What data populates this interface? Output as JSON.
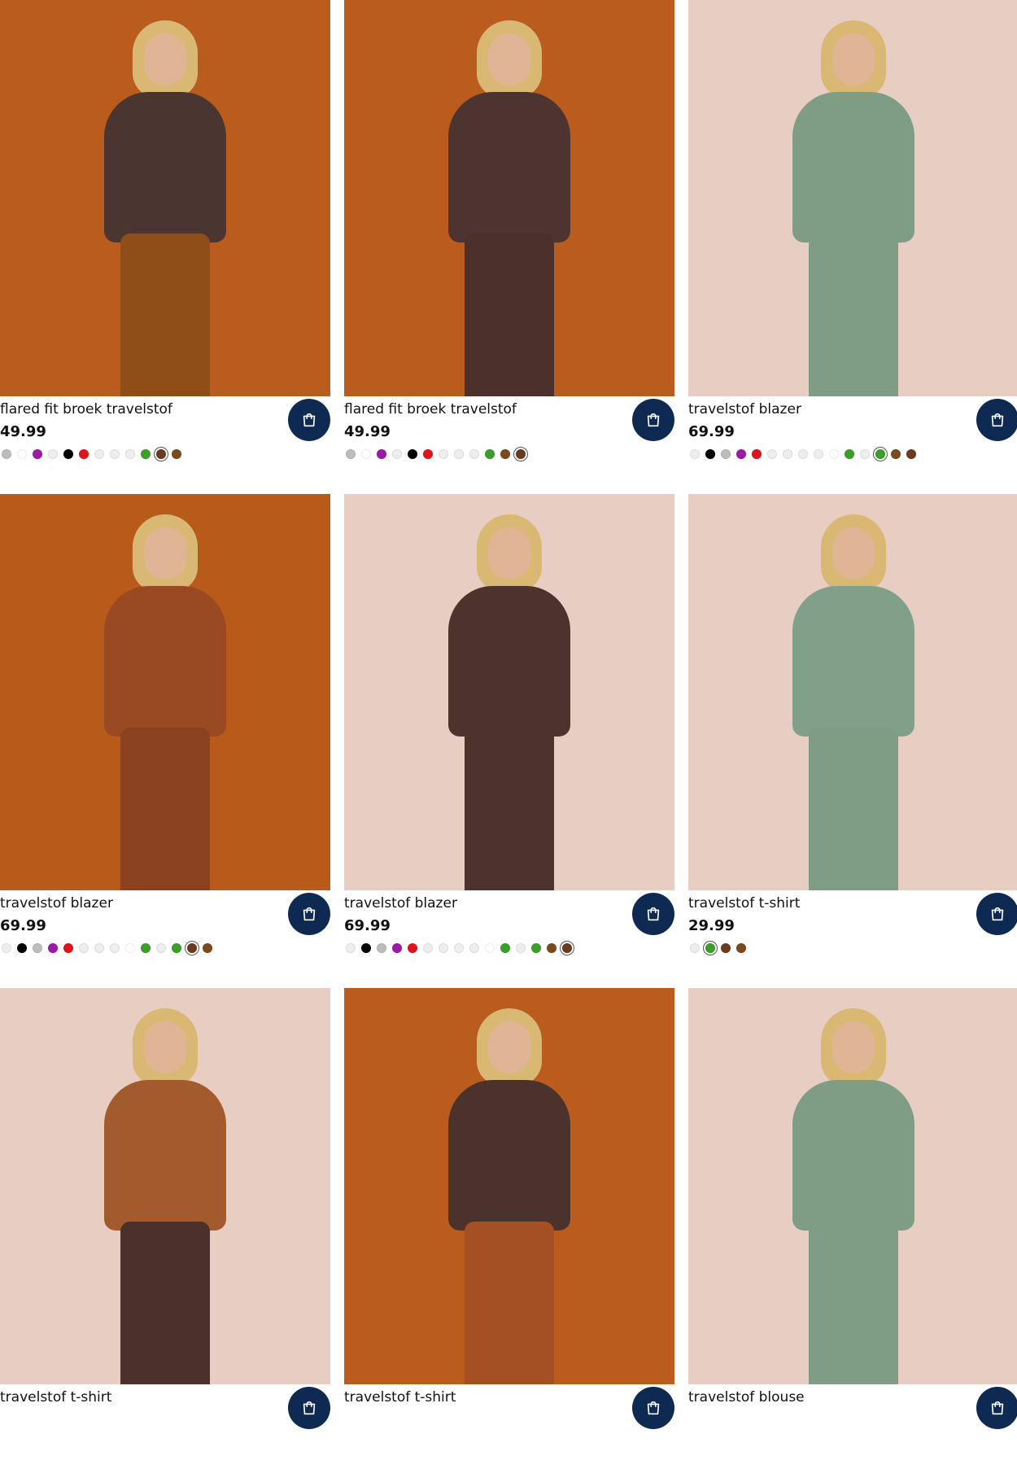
{
  "products": [
    {
      "name": "flared fit broek travelstof",
      "price": "49.99",
      "bg": "#b95c1d",
      "top_color": "#4a3530",
      "bottom_color": "#8f4e17",
      "swatches": [
        "#bdbdbd",
        "#ffffff",
        "#9c1aa8",
        "#eeeeee",
        "#000000",
        "#e1141e",
        "#eeeeee",
        "#eeeeee",
        "#eeeeee",
        "#3c9f2a",
        "#6a3b21",
        "#7b4a1e"
      ],
      "selected_swatch": 10
    },
    {
      "name": "flared fit broek travelstof",
      "price": "49.99",
      "bg": "#b95c1d",
      "top_color": "#4d3430",
      "bottom_color": "#4b302b",
      "swatches": [
        "#bdbdbd",
        "#ffffff",
        "#9c1aa8",
        "#eeeeee",
        "#000000",
        "#e1141e",
        "#eeeeee",
        "#eeeeee",
        "#eeeeee",
        "#3c9f2a",
        "#7b4a1e",
        "#6a3b21"
      ],
      "selected_swatch": 11
    },
    {
      "name": "travelstof blazer",
      "price": "69.99",
      "bg": "#e8cdc2",
      "top_color": "#7f9c85",
      "bottom_color": "#7f9c85",
      "swatches": [
        "#eeeeee",
        "#000000",
        "#bdbdbd",
        "#9c1aa8",
        "#e1141e",
        "#eeeeee",
        "#eeeeee",
        "#eeeeee",
        "#eeeeee",
        "#ffffff",
        "#3c9f2a",
        "#eeeeee",
        "#3c9f2a",
        "#7b4a1e",
        "#6a3b21"
      ],
      "selected_swatch": 12
    },
    {
      "name": "travelstof blazer",
      "price": "69.99",
      "bg": "#b85a1a",
      "top_color": "#9a4a22",
      "bottom_color": "#8b4220",
      "swatches": [
        "#eeeeee",
        "#000000",
        "#bdbdbd",
        "#9c1aa8",
        "#e1141e",
        "#eeeeee",
        "#eeeeee",
        "#eeeeee",
        "#ffffff",
        "#3c9f2a",
        "#eeeeee",
        "#3c9f2a",
        "#6a3b21",
        "#7b4a1e"
      ],
      "selected_swatch": 12
    },
    {
      "name": "travelstof blazer",
      "price": "69.99",
      "bg": "#e8cdc2",
      "top_color": "#4c332d",
      "bottom_color": "#4c332d",
      "swatches": [
        "#eeeeee",
        "#000000",
        "#bdbdbd",
        "#9c1aa8",
        "#e1141e",
        "#eeeeee",
        "#eeeeee",
        "#eeeeee",
        "#eeeeee",
        "#ffffff",
        "#3c9f2a",
        "#eeeeee",
        "#3c9f2a",
        "#7b4a1e",
        "#6a3b21"
      ],
      "selected_swatch": 14
    },
    {
      "name": "travelstof t-shirt",
      "price": "29.99",
      "bg": "#e8cdc2",
      "top_color": "#80a08a",
      "bottom_color": "#7f9c85",
      "swatches": [
        "#eeeeee",
        "#3c9f2a",
        "#6a3b21",
        "#7b4a1e"
      ],
      "selected_swatch": 1
    },
    {
      "name": "travelstof t-shirt",
      "price": "",
      "bg": "#e8cdc2",
      "top_color": "#a35a2c",
      "bottom_color": "#4b302b",
      "swatches": [],
      "selected_swatch": -1
    },
    {
      "name": "travelstof t-shirt",
      "price": "",
      "bg": "#b95c1d",
      "top_color": "#4c322d",
      "bottom_color": "#a44f24",
      "swatches": [],
      "selected_swatch": -1
    },
    {
      "name": "travelstof blouse",
      "price": "",
      "bg": "#e8cdc2",
      "top_color": "#7f9c85",
      "bottom_color": "#7f9c85",
      "swatches": [],
      "selected_swatch": -1
    }
  ],
  "icons": {
    "cart": "shopping-bag-icon"
  },
  "colors": {
    "cart_button": "#0f2a52"
  }
}
